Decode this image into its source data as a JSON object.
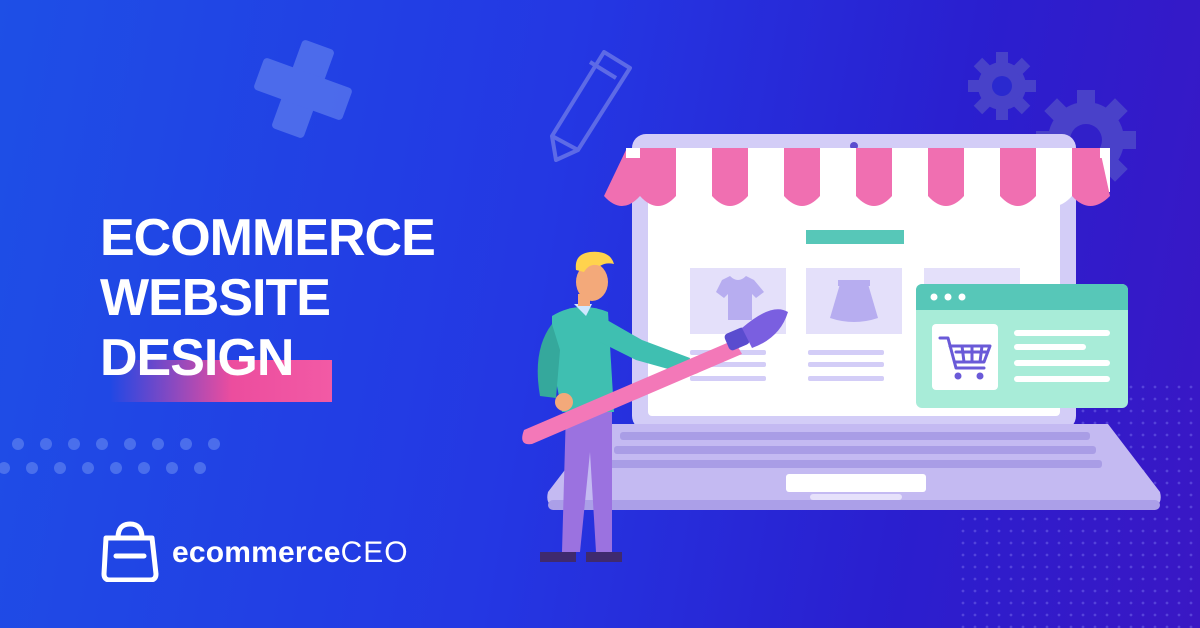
{
  "headline": {
    "line1": "ECOMMERCE",
    "line2": "WEBSITE",
    "line3": "DESIGN"
  },
  "brand": {
    "name_bold": "ecommerce",
    "name_light": "CEO"
  },
  "colors": {
    "background_start": "#1e4fe6",
    "background_end": "#3a17c4",
    "accent_pink": "#ec4d9e",
    "awning_pink": "#f472b6",
    "laptop_lilac": "#c7bdf2",
    "mint": "#8fe3c9",
    "teal": "#57c7b8"
  },
  "icons": [
    "plus-icon",
    "pencil-icon",
    "gear-icon",
    "shopping-bag-logo-icon",
    "shopping-cart-icon",
    "t-shirt-icon",
    "skirt-icon",
    "paintbrush-icon"
  ]
}
